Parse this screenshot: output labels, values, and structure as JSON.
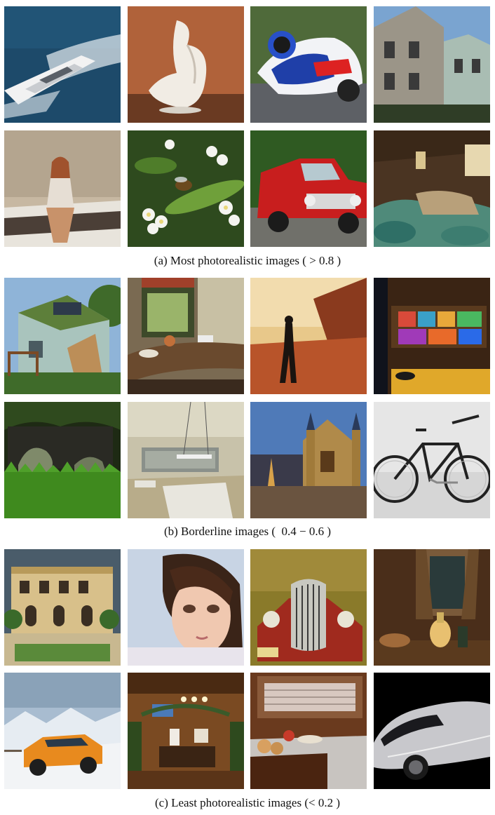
{
  "sections": [
    {
      "caption": "(a) Most photorealistic images ( > 0.8 )",
      "images": [
        {
          "name": "yacht-photo"
        },
        {
          "name": "ceramic-sculpture-photo"
        },
        {
          "name": "motorcycle-racer-photo"
        },
        {
          "name": "house-photo"
        },
        {
          "name": "woman-on-bed-photo"
        },
        {
          "name": "bee-on-flowers-photo"
        },
        {
          "name": "red-pickup-truck-photo"
        },
        {
          "name": "barn-fishing-nets-photo"
        }
      ]
    },
    {
      "caption": "(b) Borderline images (  0.4 − 0.6 )",
      "images": [
        {
          "name": "eco-house-render"
        },
        {
          "name": "interior-window-render"
        },
        {
          "name": "woman-on-path-image"
        },
        {
          "name": "shop-display-image"
        },
        {
          "name": "jungle-rocks-render"
        },
        {
          "name": "office-interior-render"
        },
        {
          "name": "gothic-building-image"
        },
        {
          "name": "bicycle-image"
        }
      ]
    },
    {
      "caption": "(c) Least photorealistic images (< 0.2 )",
      "images": [
        {
          "name": "villa-pool-render"
        },
        {
          "name": "cg-girl-portrait"
        },
        {
          "name": "vintage-car-grille-render"
        },
        {
          "name": "still-life-lamp-render"
        },
        {
          "name": "suv-in-snow-render"
        },
        {
          "name": "wooden-room-render"
        },
        {
          "name": "kitchen-counter-render"
        },
        {
          "name": "silver-concept-car-render"
        }
      ]
    }
  ]
}
